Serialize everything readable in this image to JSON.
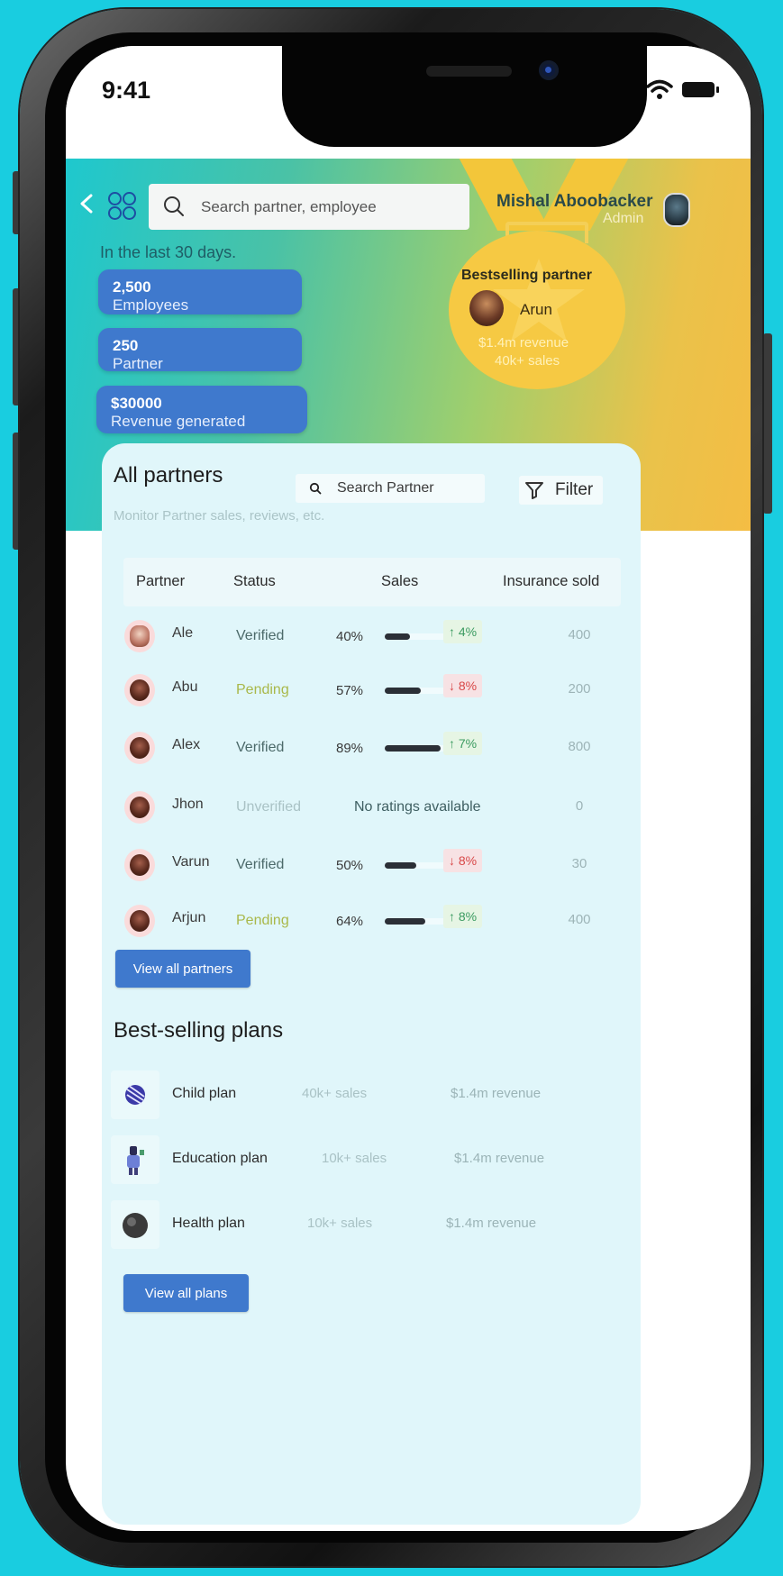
{
  "status_bar": {
    "time": "9:41"
  },
  "header": {
    "search_placeholder": "Search partner, employee",
    "user_name": "Mishal Aboobacker",
    "user_role": "Admin",
    "period_label": "In the last 30 days."
  },
  "stats": [
    {
      "value": "2,500",
      "label": "Employees"
    },
    {
      "value": "250",
      "label": "Partner"
    },
    {
      "value": "$30000",
      "label": "Revenue generated"
    }
  ],
  "bestselling": {
    "title": "Bestselling partner",
    "name": "Arun",
    "revenue": "$1.4m revenue",
    "sales": "40k+ sales"
  },
  "partners": {
    "title": "All partners",
    "subtitle": "Monitor Partner sales, reviews, etc.",
    "search_placeholder": "Search Partner",
    "filter_label": "Filter",
    "columns": [
      "Partner",
      "Status",
      "Sales",
      "Insurance sold"
    ],
    "rows": [
      {
        "name": "Ale",
        "status": "Verified",
        "pct": "40%",
        "fill": 0.4,
        "trend": "↑ 4%",
        "dir": "up",
        "sold": "400"
      },
      {
        "name": "Abu",
        "status": "Pending",
        "pct": "57%",
        "fill": 0.57,
        "trend": "↓ 8%",
        "dir": "down",
        "sold": "200"
      },
      {
        "name": "Alex",
        "status": "Verified",
        "pct": "89%",
        "fill": 0.89,
        "trend": "↑ 7%",
        "dir": "up",
        "sold": "800"
      },
      {
        "name": "Jhon",
        "status": "Unverified",
        "no_ratings": "No ratings available",
        "sold": "0"
      },
      {
        "name": "Varun",
        "status": "Verified",
        "pct": "50%",
        "fill": 0.5,
        "trend": "↓ 8%",
        "dir": "down",
        "sold": "30"
      },
      {
        "name": "Arjun",
        "status": "Pending",
        "pct": "64%",
        "fill": 0.64,
        "trend": "↑ 8%",
        "dir": "up",
        "sold": "400"
      }
    ],
    "view_all_label": "View all partners"
  },
  "plans": {
    "title": "Best-selling plans",
    "items": [
      {
        "name": "Child plan",
        "sales": "40k+ sales",
        "revenue": "$1.4m revenue",
        "icon": "child-plan-icon"
      },
      {
        "name": "Education plan",
        "sales": "10k+ sales",
        "revenue": "$1.4m revenue",
        "icon": "education-plan-icon"
      },
      {
        "name": "Health plan",
        "sales": "10k+ sales",
        "revenue": "$1.4m revenue",
        "icon": "health-plan-icon"
      }
    ],
    "view_all_label": "View all plans"
  },
  "colors": {
    "primary": "#3f79cd",
    "background": "#19cde0",
    "card": "#e0f6fa",
    "pending": "#a9b84a",
    "trend_up": "#3c9b61",
    "trend_down": "#d84848"
  }
}
